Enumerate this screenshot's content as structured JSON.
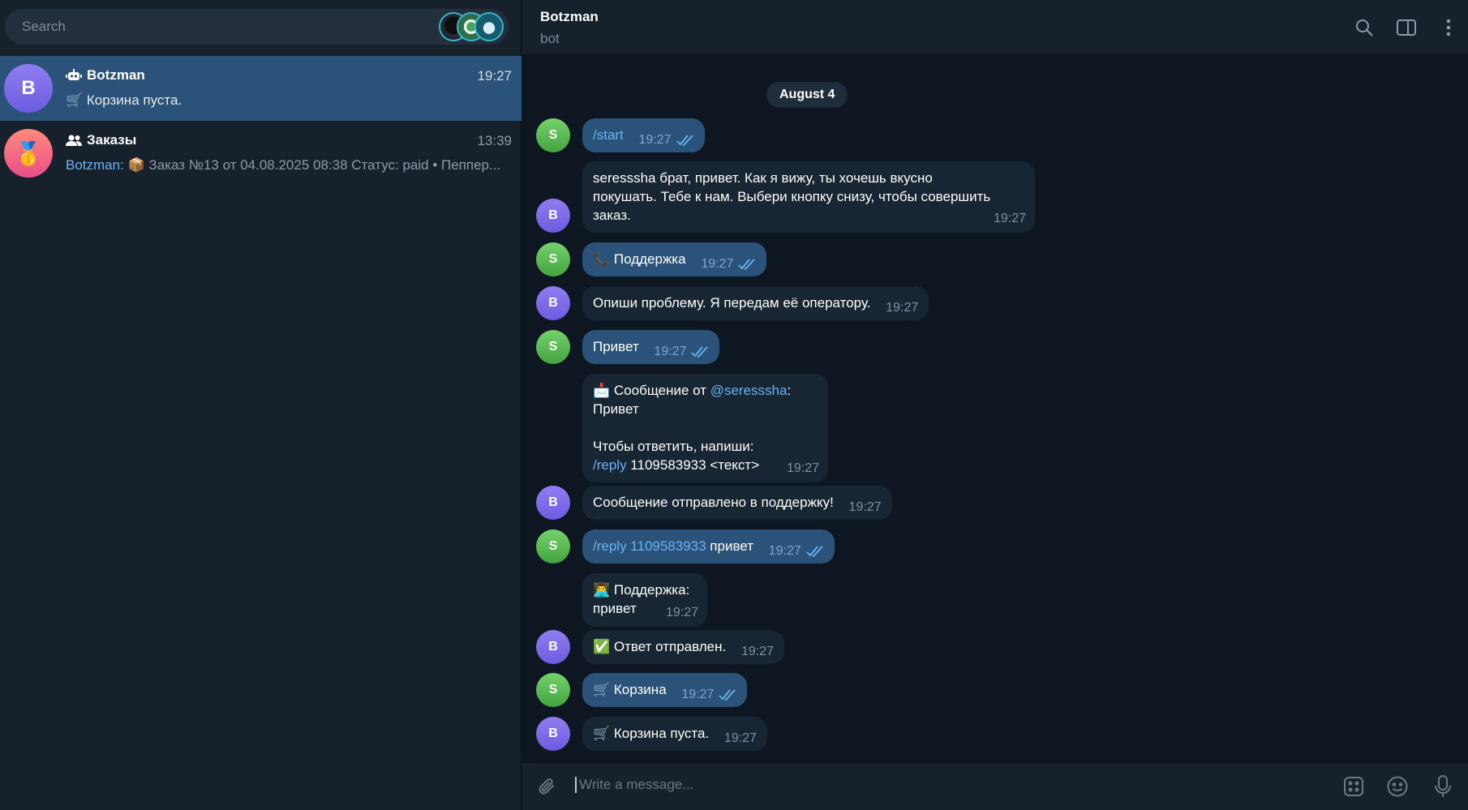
{
  "sidebar": {
    "search_placeholder": "Search",
    "chats": [
      {
        "initial": "B",
        "title": "Botzman",
        "time": "19:27",
        "preview": "🛒 Корзина пуста."
      },
      {
        "initial": "🥇",
        "title": "Заказы",
        "time": "13:39",
        "preview_sender": "Botzman:",
        "preview": " 📦 Заказ №13 от 04.08.2025 08:38 Статус: paid • Пеппер..."
      }
    ]
  },
  "header": {
    "title": "Botzman",
    "subtitle": "bot"
  },
  "messages": {
    "date": "August 4",
    "items": [
      {
        "avatar": "S",
        "text": "/start",
        "time": "19:27"
      },
      {
        "avatar": "B",
        "text": "seresssha брат, привет. Как я вижу, ты хочешь вкусно покушать. Тебе к нам. Выбери кнопку снизу, чтобы совершить заказ.",
        "time": "19:27"
      },
      {
        "avatar": "S",
        "text": "📞 Поддержка",
        "time": "19:27"
      },
      {
        "avatar": "B",
        "text": "Опиши проблему. Я передам её оператору.",
        "time": "19:27"
      },
      {
        "avatar": "S",
        "text": "Привет",
        "time": "19:27"
      },
      {
        "line1_prefix": "📩 Сообщение от ",
        "line1_mention": "@seresssha",
        "line1_suffix": ":",
        "line2": "Привет",
        "line3": "Чтобы ответить, напиши:",
        "line4_cmd": "/reply",
        "line4_rest": " 1109583933 <текст>",
        "time": "19:27"
      },
      {
        "avatar": "B",
        "text": "Сообщение отправлено в поддержку!",
        "time": "19:27"
      },
      {
        "avatar": "S",
        "cmd": "/reply 1109583933",
        "text": " привет",
        "time": "19:27"
      },
      {
        "line1": "👨‍💻 Поддержка:",
        "line2": "привет",
        "time": "19:27"
      },
      {
        "avatar": "B",
        "text": "✅ Ответ отправлен.",
        "time": "19:27"
      },
      {
        "avatar": "S",
        "text": "🛒 Корзина",
        "time": "19:27"
      },
      {
        "avatar": "B",
        "text": "🛒 Корзина пуста.",
        "time": "19:27"
      }
    ]
  },
  "composer": {
    "placeholder": "Write a message..."
  },
  "colors": {
    "accent": "#6ab3f3",
    "outgoing_bubble": "#2b5278",
    "incoming_bubble": "#182533",
    "background": "#0e1621"
  },
  "icons": [
    "search-icon",
    "sidebar-toggle-icon",
    "more-icon",
    "attach-icon",
    "bot-commands-icon",
    "emoji-icon",
    "microphone-icon"
  ]
}
